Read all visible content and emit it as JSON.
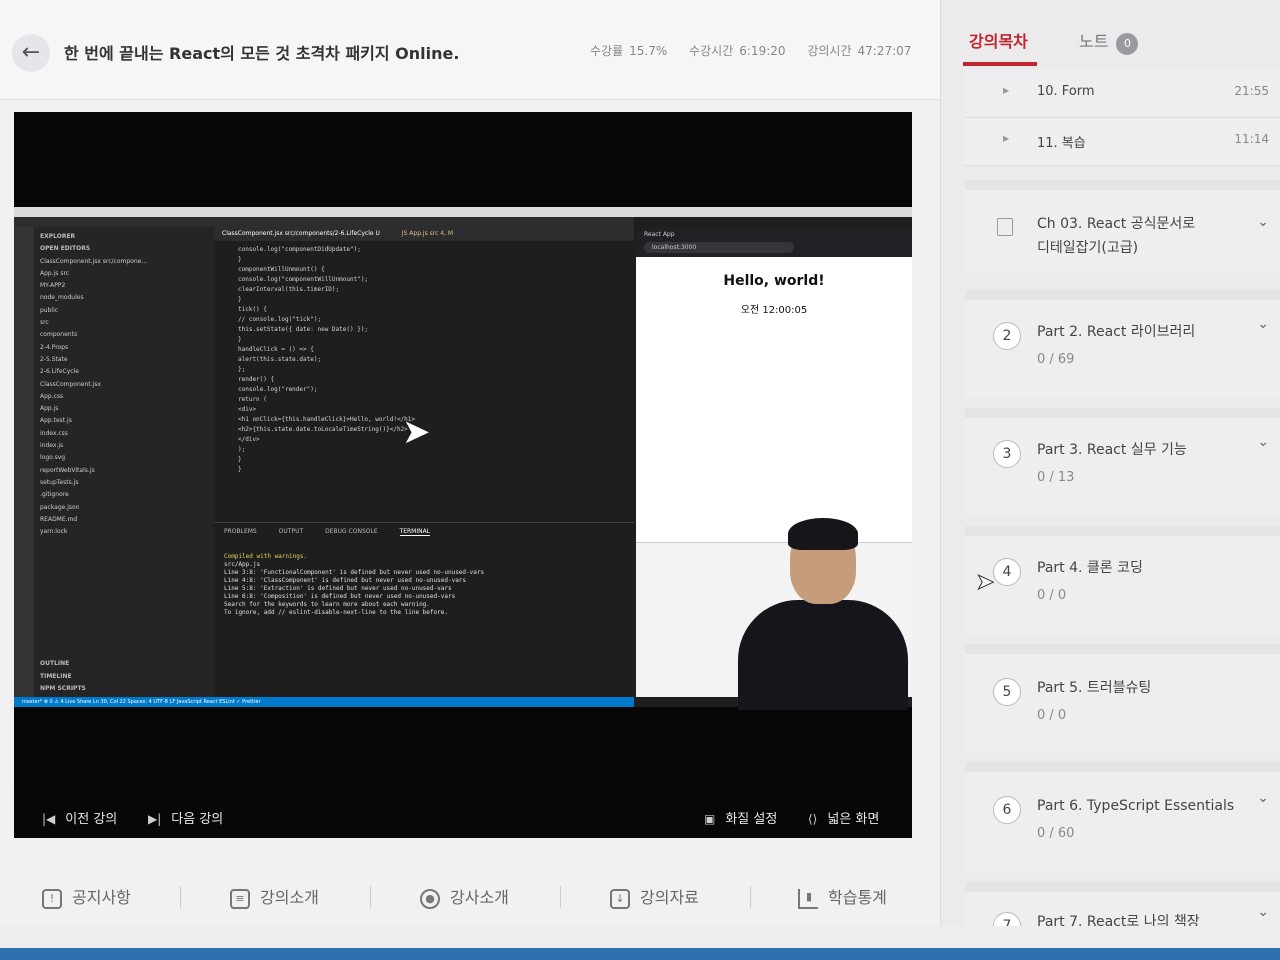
{
  "header": {
    "back_icon": "arrow-left-icon",
    "title": "한 번에 끝내는 React의 모든 것 초격차 패키지 Online.",
    "stats": [
      {
        "label": "수강률",
        "value": "15.7%"
      },
      {
        "label": "수강시간",
        "value": "6:19:20"
      },
      {
        "label": "강의시간",
        "value": "47:27:07"
      }
    ]
  },
  "video": {
    "vscode": {
      "explorer_title": "EXPLORER",
      "open_editors": "OPEN EDITORS",
      "files": [
        "ClassComponent.jsx src/compone...",
        "App.js src",
        "MY-APP2",
        "node_modules",
        "public",
        "src",
        "components",
        "2-4.Props",
        "2-5.State",
        "2-6.LifeCycle",
        "ClassComponent.jsx",
        "App.css",
        "App.js",
        "App.test.js",
        "index.css",
        "index.js",
        "logo.svg",
        "reportWebVitals.js",
        "setupTests.js",
        ".gitignore",
        "package.json",
        "README.md",
        "yarn.lock"
      ],
      "outline": [
        "OUTLINE",
        "TIMELINE",
        "NPM SCRIPTS"
      ],
      "tab_active": "ClassComponent.jsx src/components/2-6.LifeCycle U",
      "tab_other": "JS App.js src 4, M",
      "code_lines": [
        "console.log(\"componentDidUpdate\");",
        "}",
        "",
        "componentWillUnmount() {",
        "  console.log(\"componentWillUnmount\");",
        "  clearInterval(this.timerID);",
        "}",
        "",
        "tick() {",
        "  // console.log(\"tick\");",
        "  this.setState({ date: new Date() });",
        "}",
        "",
        "handleClick = () => {",
        "  alert(this.state.date);",
        "};",
        "",
        "render() {",
        "  console.log(\"render\");",
        "  return (",
        "    <div>",
        "      <h1 onClick={this.handleClick}>Hello, world!</h1>",
        "      <h2>{this.state.date.toLocaleTimeString()}</h2>",
        "    </div>",
        "  );",
        "}",
        "}"
      ],
      "terminal_tabs": [
        "PROBLEMS",
        "OUTPUT",
        "DEBUG CONSOLE",
        "TERMINAL"
      ],
      "terminal_lines": [
        "Compiled with warnings.",
        "",
        "src/App.js",
        "  Line 3:8:  'FunctionalComponent' is defined but never used  no-unused-vars",
        "  Line 4:8:  'ClassComponent' is defined but never used       no-unused-vars",
        "  Line 5:8:  'Extraction' is defined but never used           no-unused-vars",
        "  Line 6:8:  'Composition' is defined but never used          no-unused-vars",
        "",
        "Search for the keywords to learn more about each warning.",
        "To ignore, add // eslint-disable-next-line to the line before."
      ],
      "status_bar": "master*   ⊗ 0 ⚠ 4   Live Share          Ln 30, Col 22   Spaces: 4   UTF-8   LF   JavaScript React   ESLint   ✓ Prettier"
    },
    "browser": {
      "tab": "React App",
      "url": "localhost:3000",
      "hello": "Hello, world!",
      "time": "오전 12:00:05"
    },
    "controls": {
      "prev_label": "이전 강의",
      "next_label": "다음 강의",
      "display_label": "화질 설정",
      "wide_label": "넓은 화면"
    }
  },
  "bottom_nav": [
    {
      "label": "공지사항",
      "icon": "alert-icon"
    },
    {
      "label": "강의소개",
      "icon": "clipboard-icon"
    },
    {
      "label": "강사소개",
      "icon": "user-icon"
    },
    {
      "label": "강의자료",
      "icon": "download-icon"
    },
    {
      "label": "학습통계",
      "icon": "chart-icon"
    }
  ],
  "sidebar": {
    "tabs": {
      "curriculum": "강의목차",
      "notes": "노트",
      "notes_count": "0"
    },
    "lessons": [
      {
        "title": "10. Form",
        "duration": "21:55"
      },
      {
        "title": "11. 복습",
        "duration": "11:14"
      }
    ],
    "chapters": [
      {
        "num": "",
        "title_line1": "Ch 03. React 공식문서로",
        "title_line2": "디테일잡기(고급)",
        "progress": ""
      },
      {
        "num": "2",
        "title_line1": "Part 2. React 라이브러리",
        "title_line2": "",
        "progress": "0 / 69"
      },
      {
        "num": "3",
        "title_line1": "Part 3. React 실무 기능",
        "title_line2": "",
        "progress": "0 / 13"
      },
      {
        "num": "4",
        "title_line1": "Part 4. 클론 코딩",
        "title_line2": "",
        "progress": "0 / 0"
      },
      {
        "num": "5",
        "title_line1": "Part 5. 트러블슈팅",
        "title_line2": "",
        "progress": "0 / 0"
      },
      {
        "num": "6",
        "title_line1": "Part 6. TypeScript Essentials",
        "title_line2": "",
        "progress": "0 / 60"
      },
      {
        "num": "7",
        "title_line1": "Part 7. React로 나의 책장",
        "title_line2": "",
        "progress": ""
      }
    ]
  }
}
